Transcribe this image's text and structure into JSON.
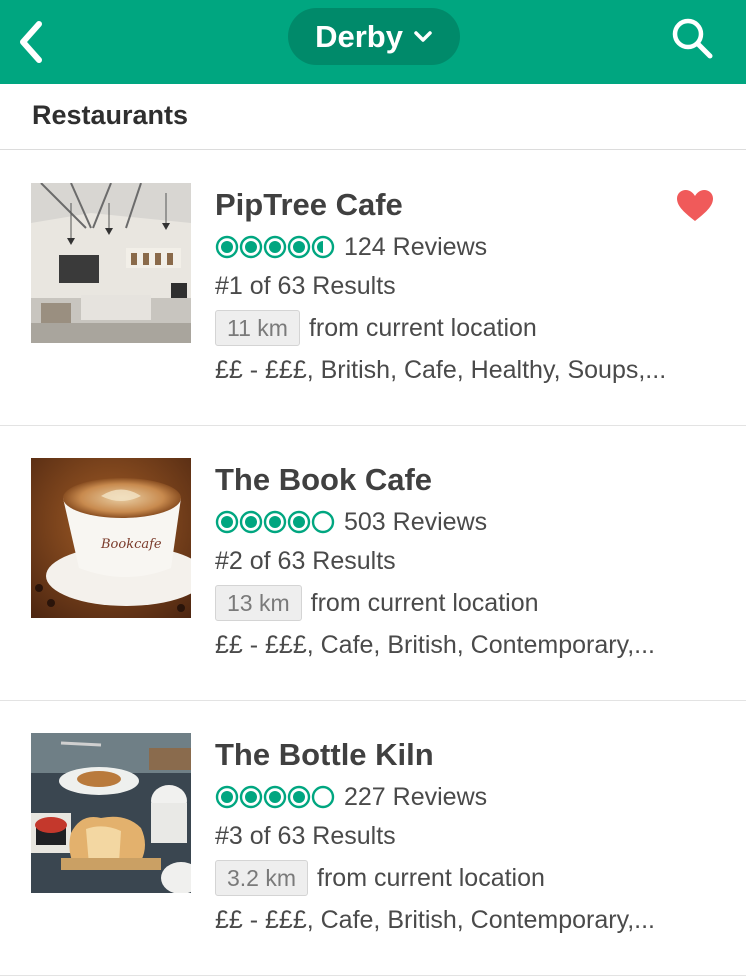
{
  "header": {
    "location": "Derby",
    "accent_color": "#00a680",
    "pill_color": "#008a6a",
    "icons": [
      "chevron-left-icon",
      "chevron-down-icon",
      "search-icon"
    ]
  },
  "section": {
    "title": "Restaurants"
  },
  "restaurants": [
    {
      "name": "PipTree Cafe",
      "rating": 4.5,
      "reviews": "124 Reviews",
      "rank": "#1 of 63 Results",
      "distance": "11 km",
      "distance_suffix": "from current location",
      "cuisine": "££ - £££, British, Cafe, Healthy, Soups,...",
      "saved": true
    },
    {
      "name": "The Book Cafe",
      "rating": 4,
      "reviews": "503 Reviews",
      "rank": "#2 of 63 Results",
      "distance": "13 km",
      "distance_suffix": "from current location",
      "cuisine": "££ - £££, Cafe, British, Contemporary,...",
      "saved": false
    },
    {
      "name": "The Bottle Kiln",
      "rating": 4,
      "reviews": "227 Reviews",
      "rank": "#3 of 63 Results",
      "distance": "3.2 km",
      "distance_suffix": "from current location",
      "cuisine": "££ - £££, Cafe, British, Contemporary,...",
      "saved": false
    }
  ]
}
